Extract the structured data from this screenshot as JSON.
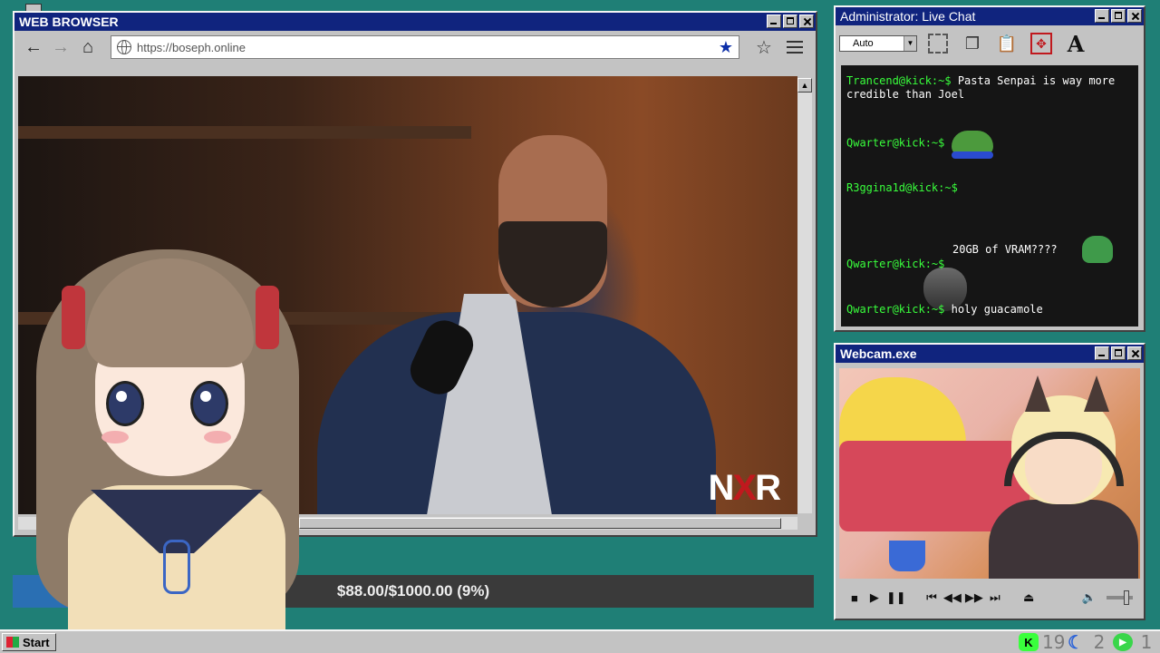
{
  "browser": {
    "title": "WEB BROWSER",
    "url": "https://boseph.online",
    "back_icon": "arrow-left-icon",
    "forward_icon": "arrow-right-icon",
    "home_icon": "home-icon",
    "video_logo": "NXR",
    "colors": {
      "titlebar": "#10247e",
      "bookmark_star": "#0d2fa8"
    }
  },
  "donation": {
    "text": "$88.00/$1000.00 (9%)",
    "progress": 0.088
  },
  "chat": {
    "title": "Administrator: Live Chat",
    "font_select": "Auto",
    "messages": [
      {
        "user": "Trancend@kick:~$",
        "text": "Pasta Senpai is way more credible than Joel",
        "emote": ""
      },
      {
        "user": "Qwarter@kick:~$",
        "text": "",
        "emote": "pepe-emote"
      },
      {
        "user": "R3ggina1d@kick:~$",
        "text": "",
        "emote": "face-emote"
      },
      {
        "user": "Qwarter@kick:~$",
        "text": "20GB of VRAM????",
        "emote": "blob-emote"
      },
      {
        "user": "Qwarter@kick:~$",
        "text": "holy guacamole",
        "emote": ""
      }
    ],
    "colors": {
      "username": "#39ff3c",
      "background": "#151515"
    }
  },
  "webcam": {
    "title": "Webcam.exe"
  },
  "taskbar": {
    "start_label": "Start",
    "tray": [
      {
        "icon": "kick-icon",
        "count": "19"
      },
      {
        "icon": "moon-icon",
        "count": "2"
      },
      {
        "icon": "play-icon",
        "count": "1"
      }
    ]
  }
}
